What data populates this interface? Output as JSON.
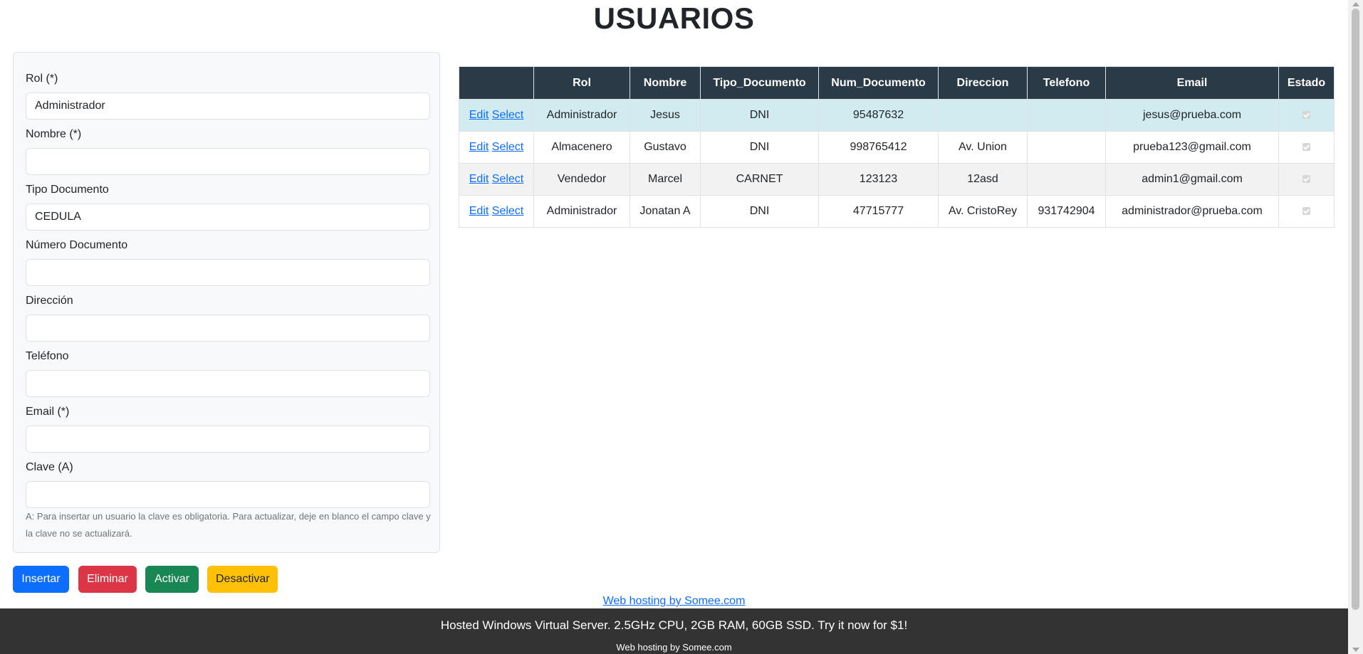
{
  "page": {
    "title": "USUARIOS"
  },
  "form": {
    "fields": [
      {
        "label": "Rol (*)",
        "value": "Administrador",
        "placeholder": ""
      },
      {
        "label": "Nombre (*)",
        "value": "",
        "placeholder": ""
      },
      {
        "label": "Tipo Documento",
        "value": "CEDULA",
        "placeholder": ""
      },
      {
        "label": "Número Documento",
        "value": "",
        "placeholder": ""
      },
      {
        "label": "Dirección",
        "value": "",
        "placeholder": ""
      },
      {
        "label": "Teléfono",
        "value": "",
        "placeholder": ""
      },
      {
        "label": "Email (*)",
        "value": "",
        "placeholder": ""
      },
      {
        "label": "Clave (A)",
        "value": "",
        "placeholder": ""
      }
    ],
    "note": "A: Para insertar un usuario la clave es obligatoria. Para actualizar, deje en blanco el campo clave y la clave no se actualizará."
  },
  "buttons": {
    "insert": "Insertar",
    "delete": "Eliminar",
    "activate": "Activar",
    "deactivate": "Desactivar"
  },
  "table": {
    "columns": [
      "",
      "Rol",
      "Nombre",
      "Tipo_Documento",
      "Num_Documento",
      "Direccion",
      "Telefono",
      "Email",
      "Estado"
    ],
    "edit_label": "Edit",
    "select_label": "Select",
    "rows": [
      {
        "rol": "Administrador",
        "nombre": "Jesus",
        "tipo_documento": "DNI",
        "num_documento": "95487632",
        "direccion": "",
        "telefono": "",
        "email": "jesus@prueba.com",
        "estado": true
      },
      {
        "rol": "Almacenero",
        "nombre": "Gustavo",
        "tipo_documento": "DNI",
        "num_documento": "998765412",
        "direccion": "Av. Union",
        "telefono": "",
        "email": "prueba123@gmail.com",
        "estado": true
      },
      {
        "rol": "Vendedor",
        "nombre": "Marcel",
        "tipo_documento": "CARNET",
        "num_documento": "123123",
        "direccion": "12asd",
        "telefono": "",
        "email": "admin1@gmail.com",
        "estado": true
      },
      {
        "rol": "Administrador",
        "nombre": "Jonatan A",
        "tipo_documento": "DNI",
        "num_documento": "47715777",
        "direccion": "Av. CristoRey",
        "telefono": "931742904",
        "email": "administrador@prueba.com",
        "estado": true
      }
    ]
  },
  "hosting": {
    "link_text": "Web hosting by Somee.com",
    "banner_text": "Hosted Windows Virtual Server. 2.5GHz CPU, 2GB RAM, 60GB SSD. Try it now for $1!",
    "sub_text": "Web hosting by Somee.com"
  },
  "colors": {
    "table_header": "#2b3a47",
    "selected_row": "#d1ebf0",
    "primary": "#0d6efd",
    "danger": "#dc3545",
    "success": "#198754",
    "warning": "#ffc107",
    "footer": "#333333"
  }
}
